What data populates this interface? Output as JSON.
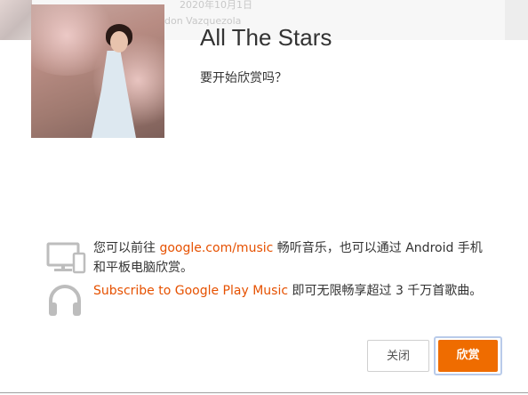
{
  "background_page": {
    "date": "2020年10月1日",
    "author": "don Vazquezola"
  },
  "dialog": {
    "album_title": "All The Stars",
    "prompt": "要开始欣赏吗？",
    "info_web": {
      "prefix": "您可以前往 ",
      "link": "google.com/music",
      "suffix": " 畅听音乐，也可以通过 Android 手机和平板电脑欣赏。"
    },
    "info_subscribe": {
      "link": "Subscribe to Google Play Music",
      "suffix": " 即可无限畅享超过 3 千万首歌曲。"
    },
    "buttons": {
      "close": "关闭",
      "listen": "欣赏"
    },
    "accent_color": "#ef6c00",
    "link_color": "#e65100"
  },
  "icons": {
    "devices": "devices-icon",
    "headphones": "headphones-icon"
  }
}
